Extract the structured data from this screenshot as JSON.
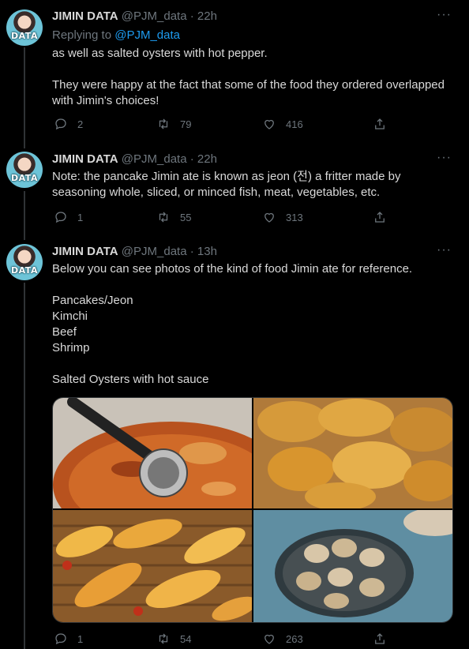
{
  "tweets": [
    {
      "name": "JIMIN DATA",
      "handle": "@PJM_data",
      "time": "· 22h",
      "replying_prefix": "Replying to",
      "replying_to": "@PJM_data",
      "text_lines": [
        "as well as salted oysters with hot pepper.",
        "",
        "They were happy at the fact that some of the food they ordered overlapped with Jimin's choices!"
      ],
      "replies": "2",
      "retweets": "79",
      "likes": "416"
    },
    {
      "name": "JIMIN DATA",
      "handle": "@PJM_data",
      "time": "· 22h",
      "text_lines": [
        "Note: the pancake Jimin ate is known as jeon (전) a fritter made by seasoning whole, sliced, or minced fish, meat, vegetables, etc."
      ],
      "replies": "1",
      "retweets": "55",
      "likes": "313"
    },
    {
      "name": "JIMIN DATA",
      "handle": "@PJM_data",
      "time": "· 13h",
      "text_lines": [
        "Below you can see photos of the kind of food Jimin ate for reference.",
        "",
        "Pancakes/Jeon",
        "Kimchi",
        "Beef",
        "Shrimp",
        "",
        "Salted Oysters with hot sauce"
      ],
      "replies": "1",
      "retweets": "54",
      "likes": "263"
    }
  ],
  "avatar_text": "DATA",
  "colors": {
    "background": "#000000",
    "text": "#d9d9d9",
    "muted": "#6e767d",
    "link": "#1d9bf0"
  },
  "icons": [
    "reply-icon",
    "retweet-icon",
    "like-icon",
    "share-icon",
    "more-icon"
  ]
}
